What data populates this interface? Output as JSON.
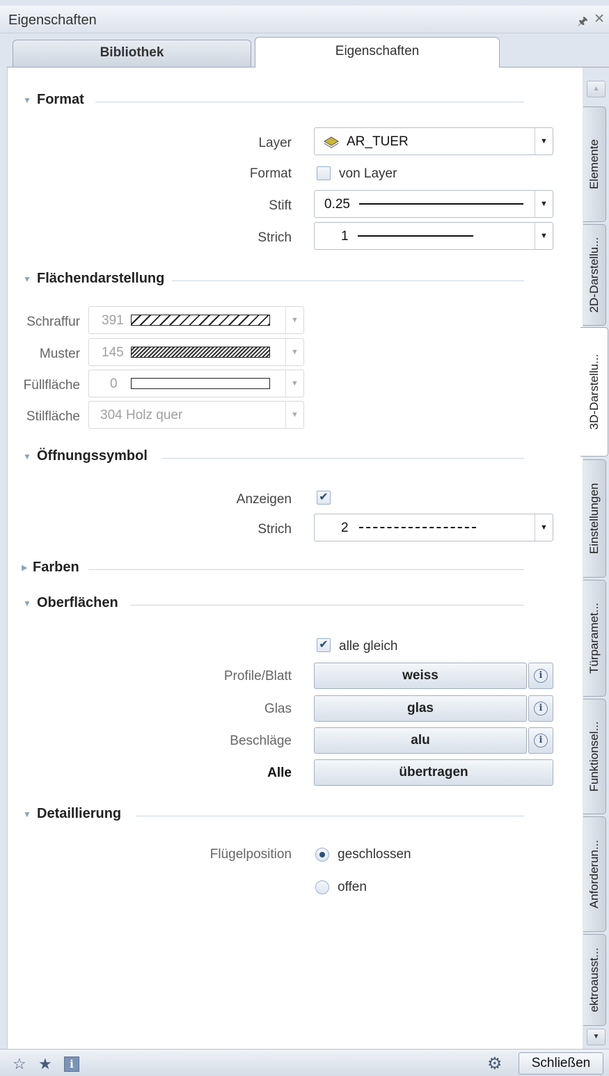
{
  "window": {
    "title": "Eigenschaften",
    "pin_icon": "pin-icon",
    "close_icon": "close-icon"
  },
  "tabs": {
    "library": "Bibliothek",
    "properties": "Eigenschaften"
  },
  "format": {
    "title": "Format",
    "layer_label": "Layer",
    "layer_value": "AR_TUER",
    "format_label": "Format",
    "from_layer_label": "von Layer",
    "from_layer_checked": false,
    "pen_label": "Stift",
    "pen_value": "0.25",
    "line_label": "Strich",
    "line_value": "1"
  },
  "surface_display": {
    "title": "Flächendarstellung",
    "hatch_label": "Schraffur",
    "hatch_value": "391",
    "pattern_label": "Muster",
    "pattern_value": "145",
    "fill_label": "Füllfläche",
    "fill_value": "0",
    "style_label": "Stilfläche",
    "style_value": "304 Holz quer"
  },
  "opening_symbol": {
    "title": "Öffnungssymbol",
    "show_label": "Anzeigen",
    "show_checked": true,
    "line_label": "Strich",
    "line_value": "2"
  },
  "colors": {
    "title": "Farben"
  },
  "surfaces": {
    "title": "Oberflächen",
    "all_same_label": "alle gleich",
    "all_same_checked": true,
    "profile_label": "Profile/Blatt",
    "profile_value": "weiss",
    "glass_label": "Glas",
    "glass_value": "glas",
    "fittings_label": "Beschläge",
    "fittings_value": "alu",
    "all_label": "Alle",
    "transfer_label": "übertragen"
  },
  "detailing": {
    "title": "Detaillierung",
    "wing_position_label": "Flügelposition",
    "closed_label": "geschlossen",
    "open_label": "offen",
    "selected": "geschlossen"
  },
  "side_tabs": [
    "Elemente",
    "2D-Darstellu...",
    "3D-Darstellu...",
    "Einstellungen",
    "Türparamet...",
    "Funktionsel...",
    "Anforderun...",
    "ektroausst..."
  ],
  "bottom": {
    "close_label": "Schließen"
  },
  "colors_hex": {
    "accent": "#2c4e7d",
    "panel_bg": "#dfe5ee"
  }
}
